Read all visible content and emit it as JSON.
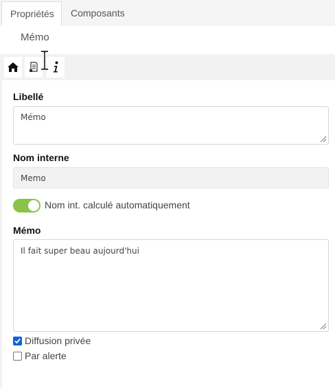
{
  "tabs": [
    {
      "label": "Propriétés",
      "active": true
    },
    {
      "label": "Composants",
      "active": false
    }
  ],
  "header": {
    "title": "Mémo"
  },
  "toolbar": {
    "icons": [
      "home-icon",
      "document-icon",
      "info-icon"
    ]
  },
  "form": {
    "libelle": {
      "label": "Libellé",
      "value": "Mémo"
    },
    "nom_interne": {
      "label": "Nom interne",
      "value": "Memo"
    },
    "auto_toggle": {
      "label": "Nom int. calculé automatiquement",
      "on": true
    },
    "memo": {
      "label": "Mémo",
      "value": "Il fait super beau aujourd'hui"
    },
    "diffusion_privee": {
      "label": "Diffusion privée",
      "checked": true
    },
    "par_alerte": {
      "label": "Par alerte",
      "checked": false
    }
  },
  "colors": {
    "toggle_on": "#8bc34a",
    "checkbox_checked": "#0a64d8"
  }
}
